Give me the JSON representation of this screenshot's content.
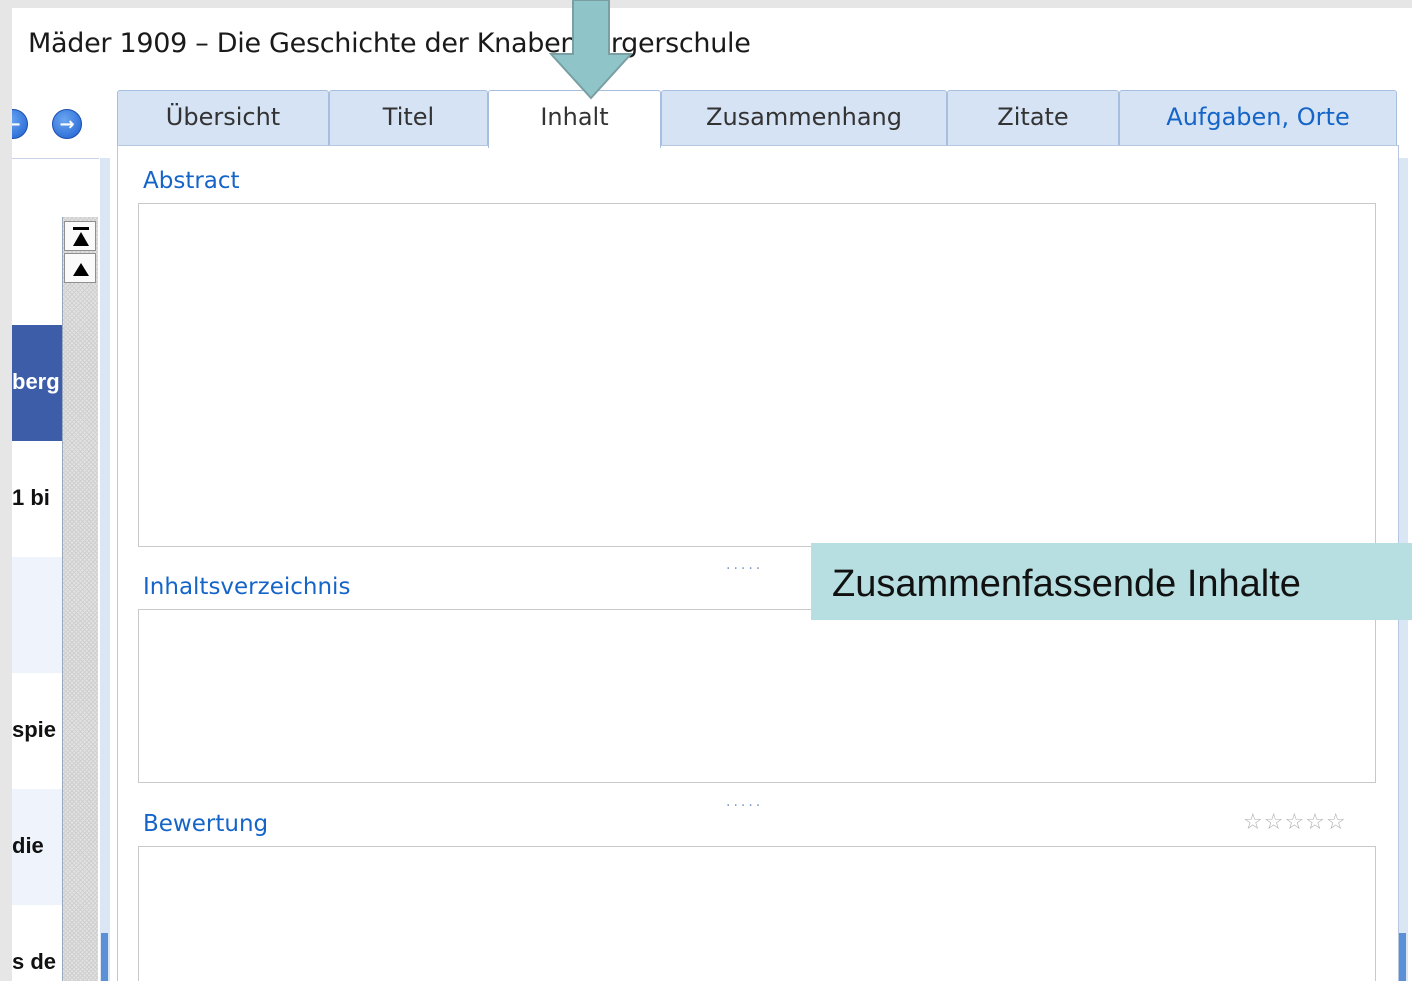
{
  "window": {
    "title": "Mäder 1909 – Die Geschichte der Knabenbürgerschule"
  },
  "nav": {
    "back_icon": "arrow-left-circle-icon",
    "forward_icon": "arrow-right-circle-icon"
  },
  "tabs": [
    {
      "label": "Übersicht"
    },
    {
      "label": "Titel"
    },
    {
      "label": "Inhalt",
      "active": true
    },
    {
      "label": "Zusammenhang"
    },
    {
      "label": "Zitate"
    },
    {
      "label": "Aufgaben, Orte"
    }
  ],
  "list": {
    "rows": [
      {
        "text": "berg",
        "selected": true
      },
      {
        "text": "1 bi"
      },
      {
        "text": ""
      },
      {
        "text": "spie"
      },
      {
        "text": "die"
      },
      {
        "text": "s de"
      }
    ]
  },
  "sections": {
    "abstract": {
      "label": "Abstract",
      "value": ""
    },
    "toc": {
      "label": "Inhaltsverzeichnis",
      "value": ""
    },
    "rating": {
      "label": "Bewertung",
      "stars": "☆☆☆☆☆",
      "value": 0,
      "max": 5
    }
  },
  "splitter": {
    "dots": "....."
  },
  "callout": {
    "text": "Zusammenfassende Inhalte"
  },
  "colors": {
    "tab_bg": "#d6e3f4",
    "link_blue": "#1565c8",
    "selected_row": "#3d5da8",
    "callout_bg": "#b7dfe1",
    "arrow": "#8fc4c8"
  }
}
